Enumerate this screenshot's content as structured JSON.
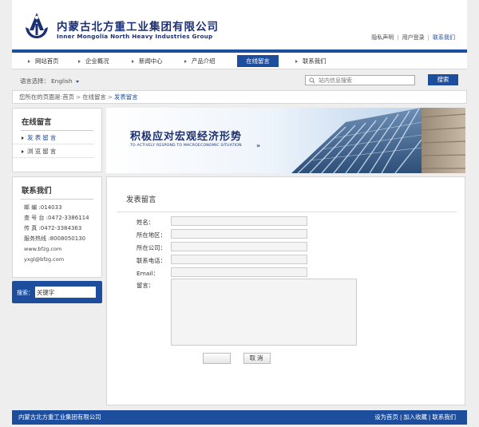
{
  "header": {
    "company_cn": "内蒙古北方重工业集团有限公司",
    "company_en": "Inner Mongolia North Heavy Industries Group",
    "links": [
      "隐私声明",
      "用户登录",
      "联系我们"
    ]
  },
  "nav": {
    "items": [
      "网站首页",
      "企业概况",
      "新闻中心",
      "产品介绍",
      "在线留言",
      "联系我们"
    ],
    "active_index": 4
  },
  "searchbar": {
    "lang_label": "语言选择：",
    "lang_value": "English",
    "placeholder": "站内信息搜索",
    "button": "搜索"
  },
  "breadcrumb": {
    "prefix": "您所在的页面是:",
    "items": [
      "首页",
      "在线留言",
      "发表留言"
    ]
  },
  "sidebar": {
    "section_title": "在线留言",
    "items": [
      "发表留言",
      "浏览留言"
    ],
    "active_index": 0,
    "contact_title": "联系我们",
    "contact": [
      "邮   编 :014033",
      "查 号 台 :0472-3386114",
      "传   真 :0472-3384363",
      "服务热线 :8008050130",
      "www.bfzg.com",
      "yxgl@bfzg.com"
    ],
    "search_label": "搜索：",
    "search_value": "关键字",
    "search_go": "GO"
  },
  "banner": {
    "title": "积极应对宏观经济形势",
    "subtitle": "TO ACTIVELY RESPOND TO MACROECONOMIC SITUATION",
    "arrows": "»"
  },
  "form": {
    "title": "发表留言",
    "fields": [
      "姓名：",
      "所在地区：",
      "所在公司：",
      "联系电话：",
      "Email：",
      "留言："
    ],
    "submit_label": "",
    "cancel_label": "取消"
  },
  "footer": {
    "company": "内蒙古北方重工业集团有限公司",
    "links": [
      "设为首页",
      "加入收藏",
      "联系我们"
    ]
  },
  "colors": {
    "brand_blue": "#1d4e9e",
    "logo_navy": "#1b2f73",
    "page_bg": "#eeeeee"
  },
  "icons": {
    "logo": "anchor-logo-icon",
    "search": "magnifier-icon",
    "dropdown": "caret-down-icon"
  }
}
